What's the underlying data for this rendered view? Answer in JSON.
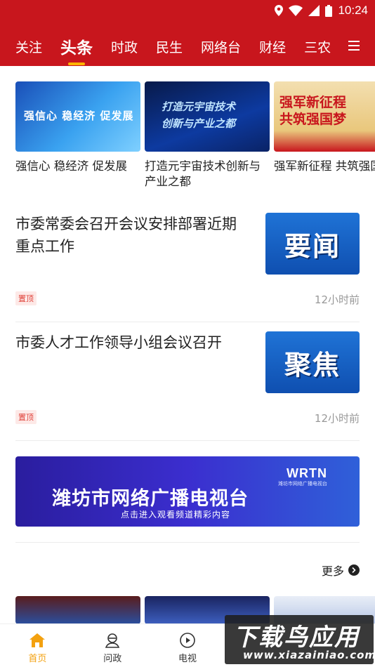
{
  "status_bar": {
    "time": "10:24"
  },
  "colors": {
    "brand_red": "#c8161d",
    "accent": "#ffb300",
    "nav_active": "#f3a110"
  },
  "tabs": [
    "关注",
    "头条",
    "时政",
    "民生",
    "网络台",
    "财经",
    "三农"
  ],
  "active_tab": "头条",
  "carousel": [
    {
      "image_text": "强信心 稳经济 促发展",
      "caption": "强信心 稳经济 促发展"
    },
    {
      "image_text_line1": "打造元宇宙技术",
      "image_text_line2": "创新与产业之都",
      "caption": "打造元宇宙技术创新与产业之都"
    },
    {
      "image_text_line1": "强军新征程",
      "image_text_line2": "共筑强国梦",
      "caption": "强军新征程 共筑强国梦"
    }
  ],
  "news": [
    {
      "title": "市委常委会召开会议安排部署近期重点工作",
      "image_text": "要闻",
      "badge": "置顶",
      "time": "12小时前"
    },
    {
      "title": "市委人才工作领导小组会议召开",
      "image_text": "聚焦",
      "badge": "置顶",
      "time": "12小时前"
    }
  ],
  "banner": {
    "logo": "WRTN",
    "logo_sub": "潍坊市网络广播电视台",
    "title": "潍坊市网络广播电视台",
    "subtitle": "点击进入观看频道精彩内容"
  },
  "more_label": "更多",
  "bottom_nav": [
    {
      "label": "首页",
      "icon": "home-icon"
    },
    {
      "label": "问政",
      "icon": "user-service-icon"
    },
    {
      "label": "电视",
      "icon": "play-circle-icon"
    }
  ],
  "watermark": {
    "line1": "下载鸟应用",
    "line2": "www.xiazainiao.com"
  }
}
